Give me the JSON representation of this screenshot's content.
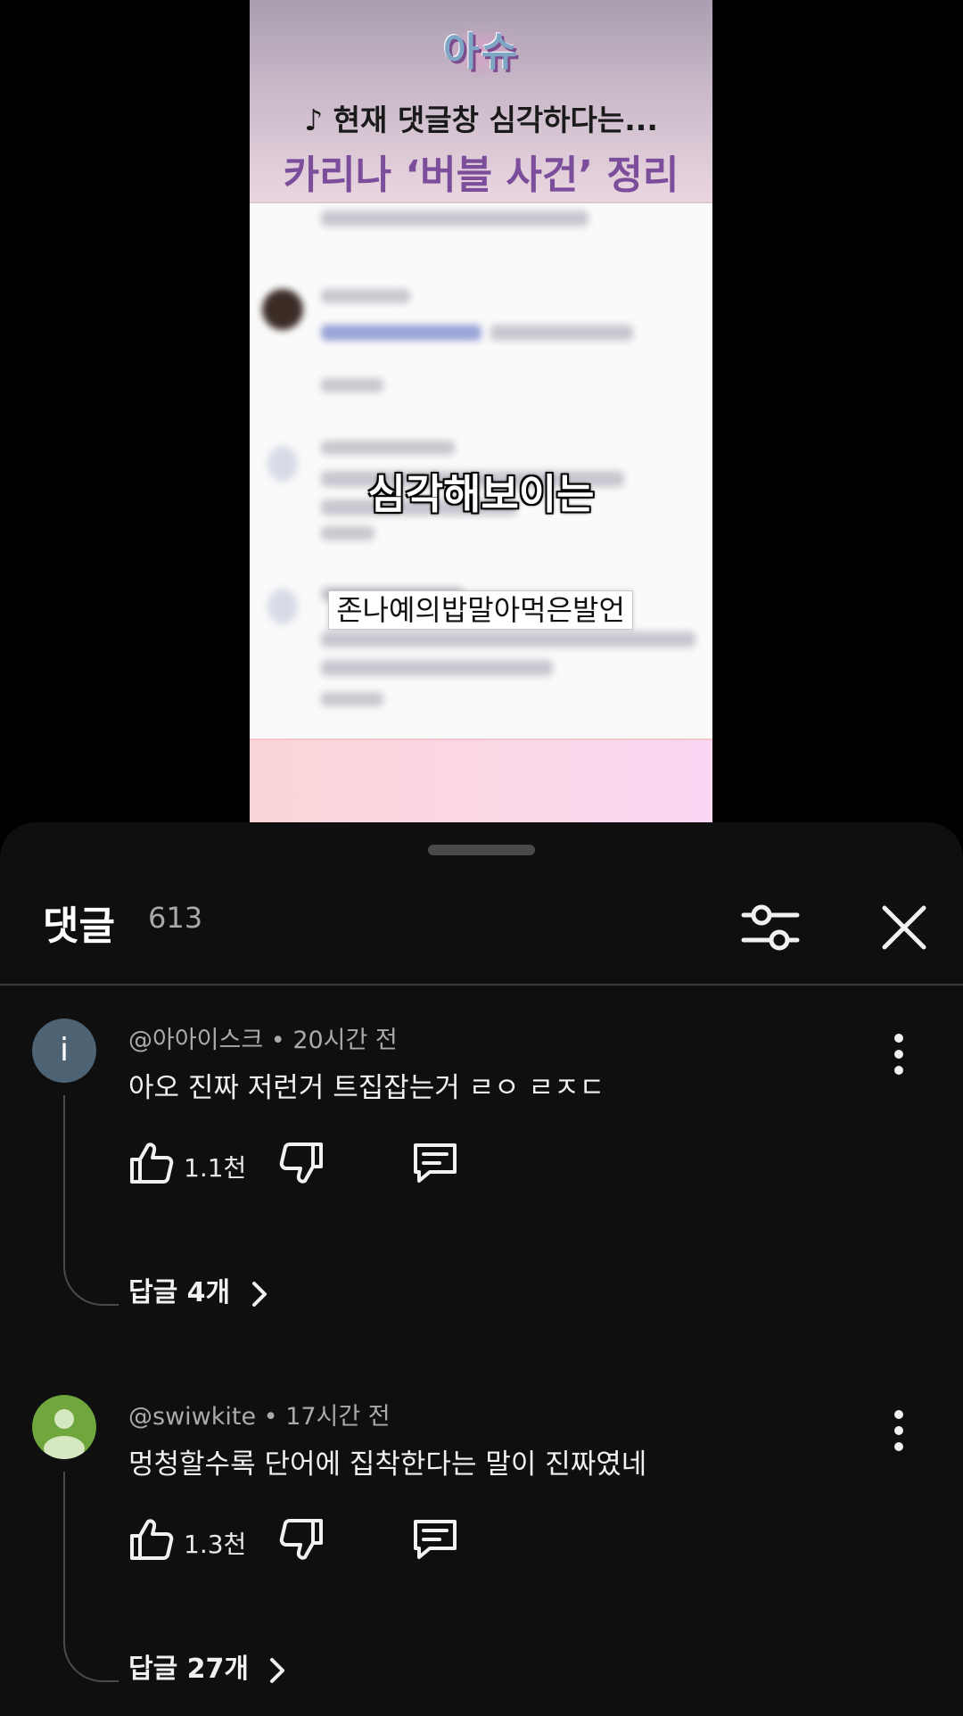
{
  "video": {
    "logo": "아슈",
    "headline_1": "♪ 현재 댓글창 심각하다는...",
    "headline_2": "카리나 ‘버블 사건’ 정리",
    "caption_1": "심각해보이는",
    "caption_2": "존나예의밥말아먹은발언"
  },
  "sheet": {
    "title": "댓글",
    "count": "613"
  },
  "comments": [
    {
      "avatar_letter": "i",
      "author": "@아아이스크",
      "time": "20시간 전",
      "text": "아오 진짜 저런거 트집잡는거 ㄹㅇ ㄹㅈㄷ",
      "likes": "1.1천",
      "replies": "답글 4개"
    },
    {
      "author": "@swiwkite",
      "time": "17시간 전",
      "text": "멍청할수록 단어에 집착한다는 말이 진짜였네",
      "likes": "1.3천",
      "replies": "답글 27개"
    }
  ],
  "icons": {
    "filter": "filter-sliders-icon",
    "close": "close-icon",
    "more": "more-vertical-icon",
    "like": "thumbs-up-icon",
    "dislike": "thumbs-down-icon",
    "reply": "comment-icon",
    "chevron": "chevron-right-icon"
  },
  "colors": {
    "sheet_bg": "#0f0f0f",
    "text_primary": "#f1f1f1",
    "text_secondary": "#aaaaaa",
    "headline_purple": "#7b4d9b"
  }
}
